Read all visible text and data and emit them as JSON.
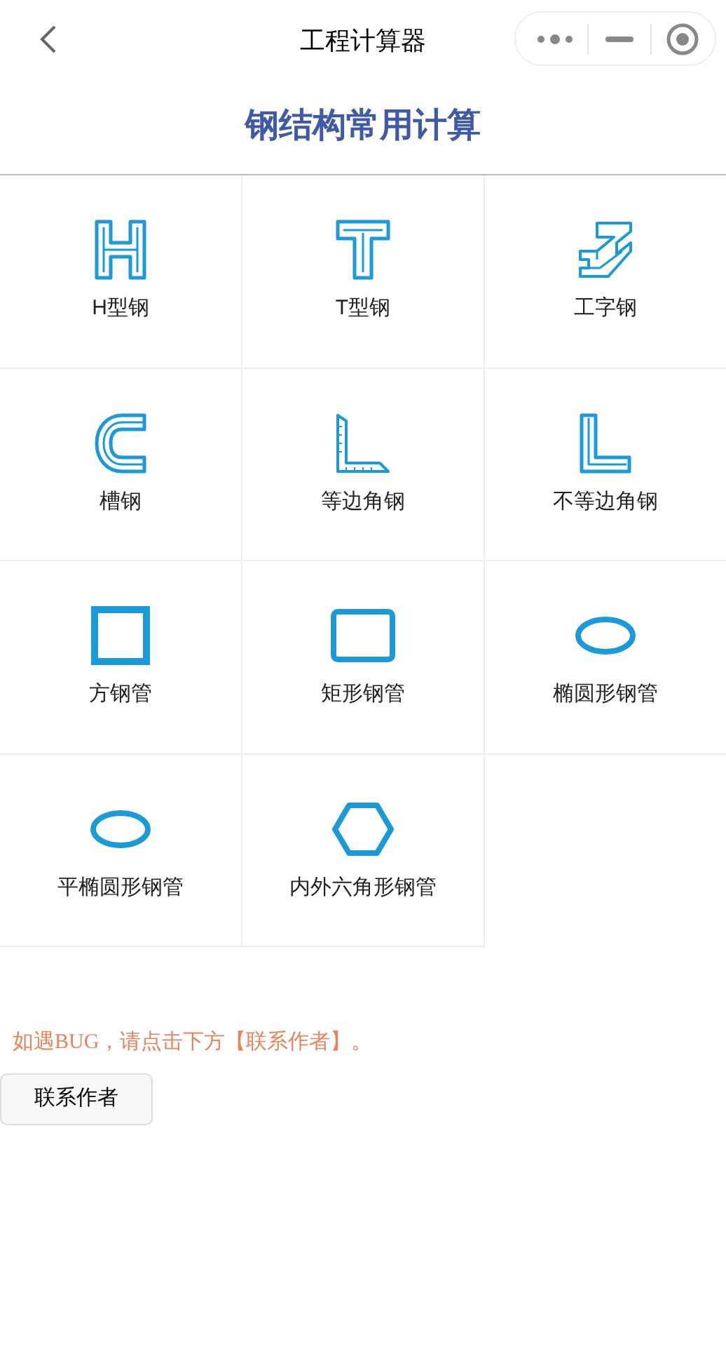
{
  "nav_bar": {
    "title": "工程计算器"
  },
  "heading": "钢结构常用计算",
  "items": [
    {
      "label": "H型钢",
      "kind": "h"
    },
    {
      "label": "T型钢",
      "kind": "t"
    },
    {
      "label": "工字钢",
      "kind": "ibeam"
    },
    {
      "label": "槽钢",
      "kind": "channel"
    },
    {
      "label": "等边角钢",
      "kind": "ruler"
    },
    {
      "label": "不等边角钢",
      "kind": "angle"
    },
    {
      "label": "方钢管",
      "kind": "square"
    },
    {
      "label": "矩形钢管",
      "kind": "rect"
    },
    {
      "label": "椭圆形钢管",
      "kind": "ellipse"
    },
    {
      "label": "平椭圆形钢管",
      "kind": "ellipse"
    },
    {
      "label": "内外六角形钢管",
      "kind": "hexagon"
    }
  ],
  "notice": "如遇BUG，请点击下方【联系作者】。",
  "contact_button": "联系作者"
}
